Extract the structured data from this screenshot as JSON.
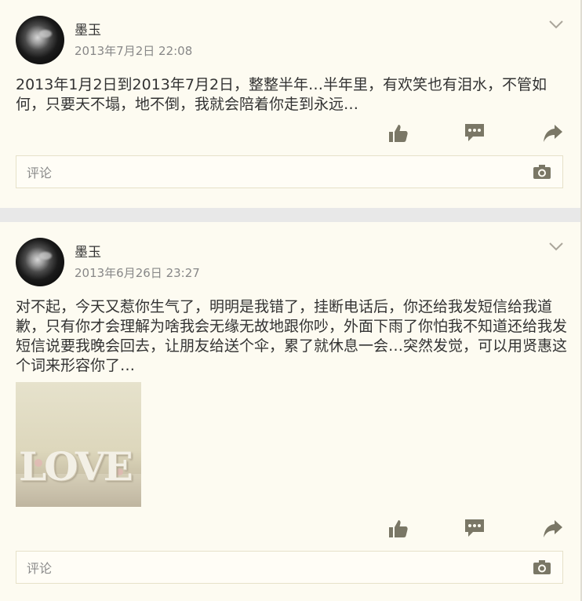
{
  "posts": [
    {
      "author": "墨玉",
      "time": "2013年7月2日 22:08",
      "text": "2013年1月2日到2013年7月2日，整整半年…半年里，有欢笑也有泪水，不管如何，只要天不塌，地不倒，我就会陪着你走到永远…",
      "comment_placeholder": "评论"
    },
    {
      "author": "墨玉",
      "time": "2013年6月26日 23:27",
      "text": "对不起，今天又惹你生气了，明明是我错了，挂断电话后，你还给我发短信给我道歉，只有你才会理解为啥我会无缘无故地跟你吵，外面下雨了你怕我不知道还给我发短信说要我晚会回去，让朋友给送个伞，累了就休息一会…突然发觉，可以用贤惠这个词来形容你了…",
      "image_text": "LOVE",
      "comment_placeholder": "评论"
    }
  ],
  "colors": {
    "icon": "#7a7766",
    "background": "#fdfbf1",
    "separator": "#e8e8e8"
  }
}
